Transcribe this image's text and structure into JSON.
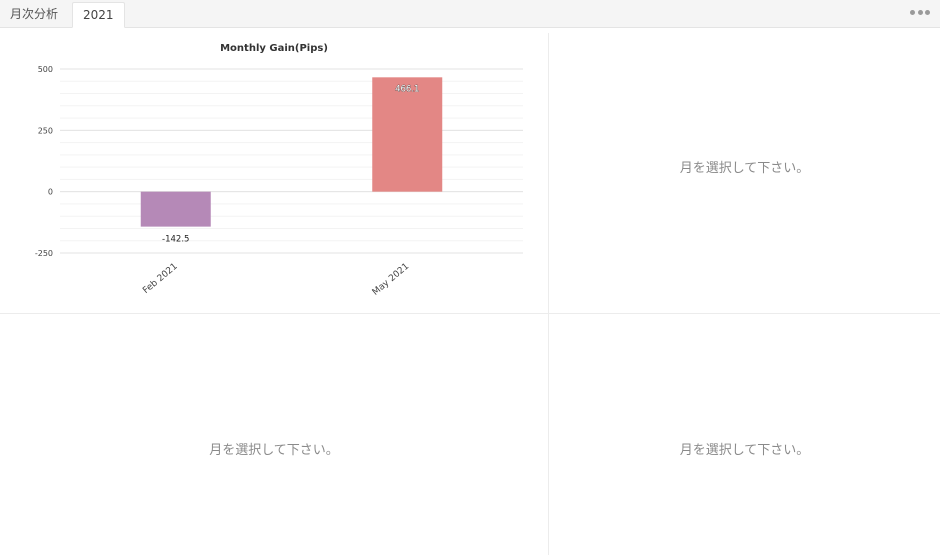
{
  "tabs": {
    "first_label": "月次分析",
    "active_label": "2021"
  },
  "more_icon": "more-dots-icon",
  "placeholder_text": "月を選択して下さい。",
  "chart_data": {
    "type": "bar",
    "title": "Monthly Gain(Pips)",
    "categories": [
      "Feb 2021",
      "May 2021"
    ],
    "values": [
      -142.5,
      466.1
    ],
    "data_labels": [
      "-142.5",
      "466.1"
    ],
    "colors": [
      "#b589b7",
      "#e38785"
    ],
    "ylim": [
      -250,
      500
    ],
    "yticks": [
      500,
      250,
      0,
      -250
    ],
    "xlabel": "",
    "ylabel": "",
    "grid": true,
    "legend": "none"
  }
}
